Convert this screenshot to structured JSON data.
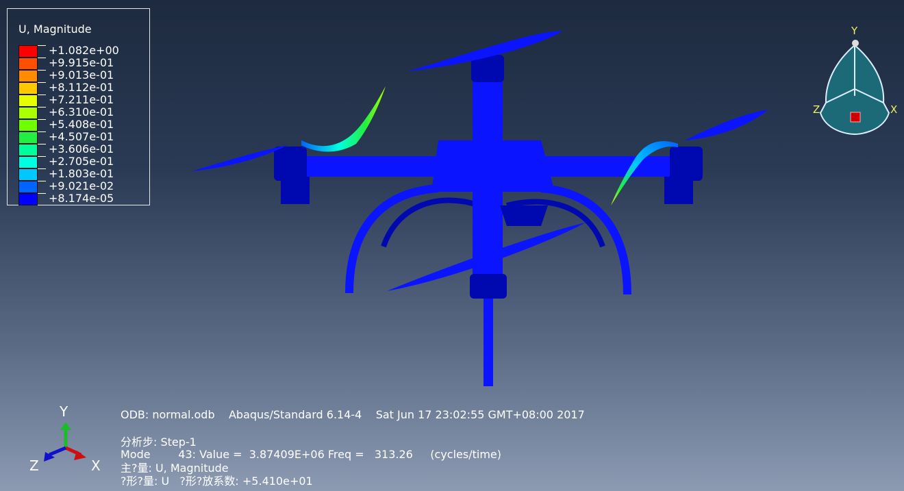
{
  "legend": {
    "title": "U, Magnitude",
    "entries": [
      {
        "label": "+1.082e+00",
        "color": "#ff0000"
      },
      {
        "label": "+9.915e-01",
        "color": "#ff4f00"
      },
      {
        "label": "+9.013e-01",
        "color": "#ff8c00"
      },
      {
        "label": "+8.112e-01",
        "color": "#ffc800"
      },
      {
        "label": "+7.211e-01",
        "color": "#e6ff00"
      },
      {
        "label": "+6.310e-01",
        "color": "#aaff00"
      },
      {
        "label": "+5.408e-01",
        "color": "#6eff00"
      },
      {
        "label": "+4.507e-01",
        "color": "#22ee44"
      },
      {
        "label": "+3.606e-01",
        "color": "#00ff9c"
      },
      {
        "label": "+2.705e-01",
        "color": "#00ffe0"
      },
      {
        "label": "+1.803e-01",
        "color": "#00c8ff"
      },
      {
        "label": "+9.021e-02",
        "color": "#0064ff"
      },
      {
        "label": "+8.174e-05",
        "color": "#0000ff"
      },
      {
        "label": "",
        "color": "#0000ff"
      }
    ]
  },
  "view_triad": {
    "y": "Y",
    "z": "Z",
    "x": "X"
  },
  "csys_triad": {
    "y": "Y",
    "z": "Z",
    "x": "X"
  },
  "info": {
    "odb_line": "ODB: normal.odb    Abaqus/Standard 6.14-4    Sat Jun 17 23:02:55 GMT+08:00 2017",
    "step_line": "分析步: Step-1",
    "mode_line": "Mode        43: Value =  3.87409E+06 Freq =   313.26     (cycles/time)",
    "primary_line": "主?量: U, Magnitude",
    "deformed_line": "?形?量: U   ?形?放系数: +5.410e+01"
  },
  "colors": {
    "model": "#0a14ff",
    "model_dark": "#0008b0",
    "triad_fill": "#1c6a78",
    "triad_edge": "#ddeeff"
  }
}
